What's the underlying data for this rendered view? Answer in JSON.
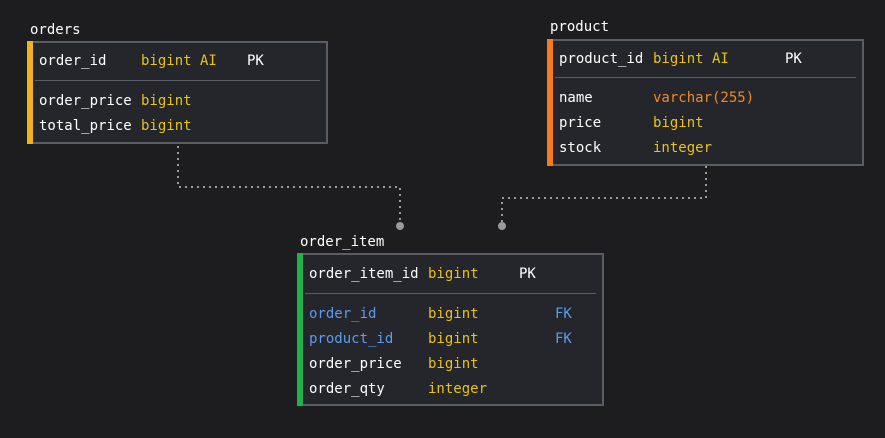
{
  "colors": {
    "background": "#1d1d20",
    "table_bg": "#25262b",
    "border": "#5a5d64",
    "text": "#ffffff",
    "type_yellow": "#e8c21a",
    "type_orange": "#f08a26",
    "fk_blue": "#5b9cf0",
    "accent_orders": "#f0b31f",
    "accent_product": "#f47b1f",
    "accent_order_item": "#22b14c",
    "connector": "#9a9a9a"
  },
  "orders": {
    "name": "orders",
    "pk": {
      "field": "order_id",
      "type": "bigint AI",
      "key": "PK"
    },
    "fields": [
      {
        "field": "order_price",
        "type": "bigint"
      },
      {
        "field": "total_price",
        "type": "bigint"
      }
    ]
  },
  "product": {
    "name": "product",
    "pk": {
      "field": "product_id",
      "type": "bigint AI",
      "key": "PK"
    },
    "fields": [
      {
        "field": "name",
        "type": "varchar(255)"
      },
      {
        "field": "price",
        "type": "bigint"
      },
      {
        "field": "stock",
        "type": "integer"
      }
    ]
  },
  "order_item": {
    "name": "order_item",
    "pk": {
      "field": "order_item_id",
      "type": "bigint",
      "key": "PK"
    },
    "fields": [
      {
        "field": "order_id",
        "type": "bigint",
        "key": "FK"
      },
      {
        "field": "product_id",
        "type": "bigint",
        "key": "FK"
      },
      {
        "field": "order_price",
        "type": "bigint",
        "key": ""
      },
      {
        "field": "order_qty",
        "type": "integer",
        "key": ""
      }
    ]
  }
}
